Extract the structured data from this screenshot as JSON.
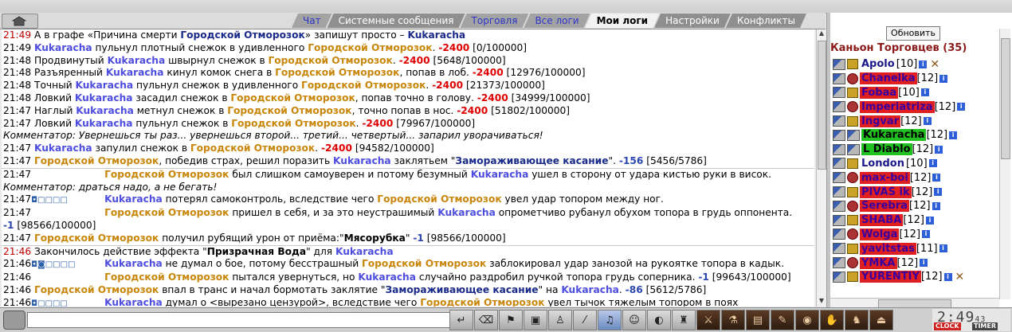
{
  "tabs": [
    {
      "label": "Чат",
      "style": "blue"
    },
    {
      "label": "Системные сообщения",
      "style": "plain"
    },
    {
      "label": "Торговля",
      "style": "blue"
    },
    {
      "label": "Все логи",
      "style": "blue"
    },
    {
      "label": "Мои логи",
      "style": "active"
    },
    {
      "label": "Настройки",
      "style": "plain"
    },
    {
      "label": "Конфликты",
      "style": "plain"
    }
  ],
  "chat": [
    {
      "sep": false,
      "parts": [
        {
          "c": "t red",
          "v": "21:49"
        },
        {
          "c": "",
          "v": " А в графе «Причина смерти "
        },
        {
          "c": "n-navy",
          "v": "Городской Отморозок"
        },
        {
          "c": "",
          "v": "» запишут просто – "
        },
        {
          "c": "n-navy",
          "v": "Kukaracha"
        }
      ]
    },
    {
      "sep": false,
      "parts": [
        {
          "c": "t",
          "v": "21:49"
        },
        {
          "c": "",
          "v": " "
        },
        {
          "c": "n-blue",
          "v": "Kukaracha"
        },
        {
          "c": "",
          "v": " пульнул плотный снежок в удивленного "
        },
        {
          "c": "n-gold",
          "v": "Городской Отморозок"
        },
        {
          "c": "",
          "v": ". "
        },
        {
          "c": "dmg",
          "v": "-2400"
        },
        {
          "c": "",
          "v": " [0/100000]"
        }
      ]
    },
    {
      "sep": false,
      "parts": [
        {
          "c": "t",
          "v": "21:48"
        },
        {
          "c": "",
          "v": " Продвинутый "
        },
        {
          "c": "n-blue",
          "v": "Kukaracha"
        },
        {
          "c": "",
          "v": " швырнул снежок в "
        },
        {
          "c": "n-gold",
          "v": "Городской Отморозок"
        },
        {
          "c": "",
          "v": ". "
        },
        {
          "c": "dmg",
          "v": "-2400"
        },
        {
          "c": "",
          "v": " [5648/100000]"
        }
      ]
    },
    {
      "sep": false,
      "parts": [
        {
          "c": "t",
          "v": "21:48"
        },
        {
          "c": "",
          "v": " Разъяренный "
        },
        {
          "c": "n-blue",
          "v": "Kukaracha"
        },
        {
          "c": "",
          "v": " кинул комок снега в "
        },
        {
          "c": "n-gold",
          "v": "Городской Отморозок"
        },
        {
          "c": "",
          "v": ", попав в лоб. "
        },
        {
          "c": "dmg",
          "v": "-2400"
        },
        {
          "c": "",
          "v": " [12976/100000]"
        }
      ]
    },
    {
      "sep": false,
      "parts": [
        {
          "c": "t",
          "v": "21:48"
        },
        {
          "c": "",
          "v": " Точный "
        },
        {
          "c": "n-blue",
          "v": "Kukaracha"
        },
        {
          "c": "",
          "v": " пульнул снежок в удивленного "
        },
        {
          "c": "n-gold",
          "v": "Городской Отморозок"
        },
        {
          "c": "",
          "v": ". "
        },
        {
          "c": "dmg",
          "v": "-2400"
        },
        {
          "c": "",
          "v": " [21373/100000]"
        }
      ]
    },
    {
      "sep": false,
      "parts": [
        {
          "c": "t",
          "v": "21:48"
        },
        {
          "c": "",
          "v": " Ловкий "
        },
        {
          "c": "n-blue",
          "v": "Kukaracha"
        },
        {
          "c": "",
          "v": " засадил снежок в "
        },
        {
          "c": "n-gold",
          "v": "Городской Отморозок"
        },
        {
          "c": "",
          "v": ", попав точно в голову. "
        },
        {
          "c": "dmg",
          "v": "-2400"
        },
        {
          "c": "",
          "v": " [34999/100000]"
        }
      ]
    },
    {
      "sep": false,
      "parts": [
        {
          "c": "t",
          "v": "21:47"
        },
        {
          "c": "",
          "v": " Наглый "
        },
        {
          "c": "n-blue",
          "v": "Kukaracha"
        },
        {
          "c": "",
          "v": " метнул снежок в "
        },
        {
          "c": "n-gold",
          "v": "Городской Отморозок"
        },
        {
          "c": "",
          "v": ", точно попав в нос. "
        },
        {
          "c": "dmg",
          "v": "-2400"
        },
        {
          "c": "",
          "v": " [51802/100000]"
        }
      ]
    },
    {
      "sep": false,
      "parts": [
        {
          "c": "t",
          "v": "21:47"
        },
        {
          "c": "",
          "v": " Ловкий "
        },
        {
          "c": "n-blue",
          "v": "Kukaracha"
        },
        {
          "c": "",
          "v": " пульнул снежок в "
        },
        {
          "c": "n-gold",
          "v": "Городской Отморозок"
        },
        {
          "c": "",
          "v": ". "
        },
        {
          "c": "dmg",
          "v": "-2400"
        },
        {
          "c": "",
          "v": " [79967/100000]"
        }
      ]
    },
    {
      "sep": false,
      "parts": [
        {
          "c": "ital",
          "v": "Комментатор: Увернешься ты раз... увернешься второй... третий... четвертый... запарил уворачиваться!"
        }
      ]
    },
    {
      "sep": false,
      "parts": [
        {
          "c": "t",
          "v": "21:47"
        },
        {
          "c": "",
          "v": " "
        },
        {
          "c": "n-blue",
          "v": "Kukaracha"
        },
        {
          "c": "",
          "v": " запулил снежок в "
        },
        {
          "c": "n-gold",
          "v": "Городской Отморозок"
        },
        {
          "c": "",
          "v": ". "
        },
        {
          "c": "dmg",
          "v": "-2400"
        },
        {
          "c": "",
          "v": " [94582/100000]"
        }
      ]
    },
    {
      "sep": false,
      "parts": [
        {
          "c": "t",
          "v": "21:47"
        },
        {
          "c": "",
          "v": " "
        },
        {
          "c": "n-gold",
          "v": "Городской Отморозок"
        },
        {
          "c": "",
          "v": ", победив страх, решил поразить "
        },
        {
          "c": "n-blue",
          "v": "Kukaracha"
        },
        {
          "c": "",
          "v": " заклятьем \""
        },
        {
          "c": "spell",
          "v": "Замораживающее касание"
        },
        {
          "c": "",
          "v": "\". "
        },
        {
          "c": "dmg-blue",
          "v": "-156"
        },
        {
          "c": "",
          "v": " [5456/5786]"
        }
      ]
    },
    {
      "sep": true,
      "parts": [
        {
          "c": "t",
          "v": "21:47"
        },
        {
          "c": "boxes",
          "v": " "
        },
        {
          "c": "n-gold",
          "v": "Городской Отморозок"
        },
        {
          "c": "",
          "v": " был слишком самоуверен и потому безумный "
        },
        {
          "c": "n-blue",
          "v": "Kukaracha"
        },
        {
          "c": "",
          "v": " ушел в сторону от удара кистью руки в висок."
        }
      ]
    },
    {
      "sep": false,
      "parts": [
        {
          "c": "ital",
          "v": "Комментатор: драться надо, а не бегать!"
        }
      ]
    },
    {
      "sep": false,
      "parts": [
        {
          "c": "t",
          "v": "21:47"
        },
        {
          "c": "boxes",
          "v": " ◘□□□□"
        },
        {
          "c": "n-blue",
          "v": "Kukaracha"
        },
        {
          "c": "",
          "v": " потерял самоконтроль, вследствие чего "
        },
        {
          "c": "n-gold",
          "v": "Городской Отморозок"
        },
        {
          "c": "",
          "v": " увел удар топором между ног."
        }
      ]
    },
    {
      "sep": false,
      "parts": [
        {
          "c": "t",
          "v": "21:47"
        },
        {
          "c": "boxes",
          "v": " "
        },
        {
          "c": "n-gold",
          "v": "Городской Отморозок"
        },
        {
          "c": "",
          "v": " пришел в себя, и за это неустрашимый "
        },
        {
          "c": "n-blue",
          "v": "Kukaracha"
        },
        {
          "c": "",
          "v": " опрометчиво рубанул обухом топора в грудь оппонента."
        }
      ]
    },
    {
      "sep": false,
      "parts": [
        {
          "c": "dmg-blue",
          "v": "-1"
        },
        {
          "c": "",
          "v": " [98566/100000]"
        }
      ]
    },
    {
      "sep": false,
      "parts": [
        {
          "c": "t",
          "v": "21:47"
        },
        {
          "c": "",
          "v": " "
        },
        {
          "c": "n-gold",
          "v": "Городской Отморозок"
        },
        {
          "c": "",
          "v": " получил рубящий урон от приёма:\""
        },
        {
          "c": "bold",
          "v": "Мясорубка"
        },
        {
          "c": "",
          "v": "\" "
        },
        {
          "c": "dmg-blue",
          "v": "-1"
        },
        {
          "c": "",
          "v": " [98566/100000]"
        }
      ]
    },
    {
      "sep": true,
      "parts": [
        {
          "c": "t red",
          "v": "21:46"
        },
        {
          "c": "",
          "v": " Закончилось действие эффекта \""
        },
        {
          "c": "bold",
          "v": "Призрачная Вода"
        },
        {
          "c": "",
          "v": "\" для "
        },
        {
          "c": "n-blue",
          "v": "Kukaracha"
        }
      ]
    },
    {
      "sep": false,
      "parts": [
        {
          "c": "t",
          "v": "21:46"
        },
        {
          "c": "boxes",
          "v": " ◘◙□□□□"
        },
        {
          "c": "n-blue",
          "v": "Kukaracha"
        },
        {
          "c": "",
          "v": " не думал о бое, потому бесстрашный "
        },
        {
          "c": "n-gold",
          "v": "Городской Отморозок"
        },
        {
          "c": "",
          "v": " заблокировал удар занозой на рукоятке топора в кадык."
        }
      ]
    },
    {
      "sep": false,
      "parts": [
        {
          "c": "t",
          "v": "21:46"
        },
        {
          "c": "boxes",
          "v": " "
        },
        {
          "c": "n-gold",
          "v": "Городской Отморозок"
        },
        {
          "c": "",
          "v": " пытался увернуться, но "
        },
        {
          "c": "n-blue",
          "v": "Kukaracha"
        },
        {
          "c": "",
          "v": " случайно раздробил ручкой топора грудь соперника. "
        },
        {
          "c": "dmg-blue",
          "v": "-1"
        },
        {
          "c": "",
          "v": " [99643/100000]"
        }
      ]
    },
    {
      "sep": false,
      "parts": [
        {
          "c": "t",
          "v": "21:46"
        },
        {
          "c": "",
          "v": " "
        },
        {
          "c": "n-gold",
          "v": "Городской Отморозок"
        },
        {
          "c": "",
          "v": " впал в транс и начал бормотать заклятие \""
        },
        {
          "c": "spell",
          "v": "Замораживающее касание"
        },
        {
          "c": "",
          "v": "\" на "
        },
        {
          "c": "n-blue",
          "v": "Kukaracha"
        },
        {
          "c": "",
          "v": ". "
        },
        {
          "c": "dmg-blue",
          "v": "-86"
        },
        {
          "c": "",
          "v": " [5612/5786]"
        }
      ]
    },
    {
      "sep": false,
      "parts": [
        {
          "c": "t",
          "v": "21:46"
        },
        {
          "c": "boxes",
          "v": " ◘□□□□"
        },
        {
          "c": "n-blue",
          "v": "Kukaracha"
        },
        {
          "c": "",
          "v": " думал о <вырезано цензурой>, вследствие чего "
        },
        {
          "c": "n-gold",
          "v": "Городской Отморозок"
        },
        {
          "c": "",
          "v": " увел тычок тяжелым топором в поях"
        }
      ]
    }
  ],
  "side": {
    "refresh_label": "Обновить",
    "location_title": "Каньон Торговцев (35)",
    "users": [
      {
        "name": "Apolo",
        "level": "[10]",
        "bg": "plain",
        "icon": "i3",
        "x": true
      },
      {
        "name": "Chanelka",
        "level": "[12]",
        "bg": "redbg",
        "icon": "i2",
        "x": false
      },
      {
        "name": "Fobaa",
        "level": "[10]",
        "bg": "redbg",
        "icon": "i3",
        "x": false
      },
      {
        "name": "Imperiatriza",
        "level": "[12]",
        "bg": "redbg",
        "icon": "i2",
        "x": false
      },
      {
        "name": "Ingvar",
        "level": "[12]",
        "bg": "redbg",
        "icon": "i3",
        "x": false
      },
      {
        "name": "Kukaracha",
        "level": "[12]",
        "bg": "greenbg",
        "icon": "i1",
        "x": false
      },
      {
        "name": "L Diablo",
        "level": "[12]",
        "bg": "greenbg",
        "icon": "i1",
        "x": false
      },
      {
        "name": "London",
        "level": "[10]",
        "bg": "plain",
        "icon": "i3",
        "x": false
      },
      {
        "name": "max-boi",
        "level": "[12]",
        "bg": "redbg",
        "icon": "i2",
        "x": false
      },
      {
        "name": "PIVAS ik",
        "level": "[12]",
        "bg": "redbg",
        "icon": "i3",
        "x": false
      },
      {
        "name": "Serebra",
        "level": "[12]",
        "bg": "redbg",
        "icon": "i2",
        "x": false
      },
      {
        "name": "SHABA",
        "level": "[12]",
        "bg": "redbg",
        "icon": "i3",
        "x": false
      },
      {
        "name": "Wolga",
        "level": "[12]",
        "bg": "redbg",
        "icon": "i2",
        "x": false
      },
      {
        "name": "yavitstas",
        "level": "[11]",
        "bg": "redbg",
        "icon": "i3",
        "x": false
      },
      {
        "name": "YMKA",
        "level": "[12]",
        "bg": "redbg",
        "icon": "i2",
        "x": false
      },
      {
        "name": "YURENTIY",
        "level": "[12]",
        "bg": "redbg",
        "icon": "i3",
        "x": true
      }
    ]
  },
  "bottom": {
    "message_placeholder": "",
    "tools": [
      "enter-icon",
      "eraser-icon",
      "filter-icon",
      "save-icon",
      "walk-icon",
      "slash-icon",
      "notes-icon",
      "smiley-icon",
      "helmet-icon",
      "bag-icon",
      "sword-icon",
      "potion-icon",
      "chest-icon",
      "scroll-icon",
      "coin-icon",
      "hand-icon",
      "bear-icon",
      "exit-icon"
    ],
    "clock": {
      "time": "2:49",
      "seconds": "43",
      "label_clock": "CLOCK",
      "label_timer": "TIMER"
    }
  }
}
